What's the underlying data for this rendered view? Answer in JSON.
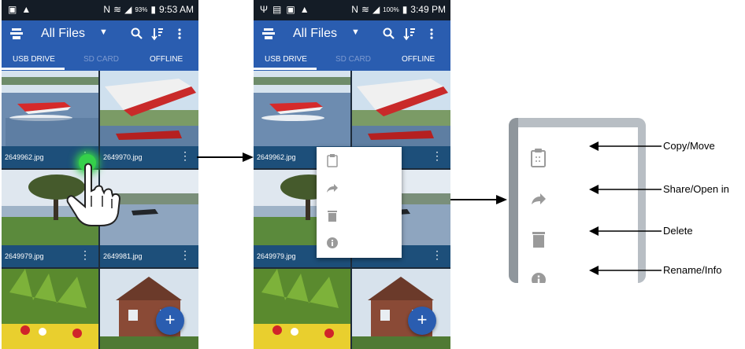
{
  "phone1": {
    "status_time": "9:53 AM",
    "battery": "93%",
    "title": "All Files",
    "tabs": [
      "USB DRIVE",
      "SD CARD",
      "OFFLINE"
    ],
    "files": [
      "2649962.jpg",
      "2649970.jpg",
      "2649979.jpg",
      "2649981.jpg"
    ],
    "fab": "+"
  },
  "phone2": {
    "status_time": "3:49 PM",
    "battery": "100%",
    "title": "All Files",
    "tabs": [
      "USB DRIVE",
      "SD CARD",
      "OFFLINE"
    ],
    "files": [
      "2649962.jpg",
      "2649979.jpg"
    ],
    "fab": "+"
  },
  "menu_labels": {
    "copy_move": "Copy/Move",
    "share_open": "Share/Open in",
    "delete": "Delete",
    "rename_info": "Rename/Info"
  },
  "icons": {
    "overflow": "vertical-ellipsis",
    "search": "magnifier",
    "sort": "sort-arrow",
    "copy_move": "clipboard-icon",
    "share": "share-arrow-icon",
    "delete": "trash-icon",
    "info": "info-icon"
  },
  "colors": {
    "accent": "#2a5db0",
    "caption_bar": "#1d4f7a",
    "status_bar": "#141c26",
    "touch_glow": "#35d04a"
  }
}
